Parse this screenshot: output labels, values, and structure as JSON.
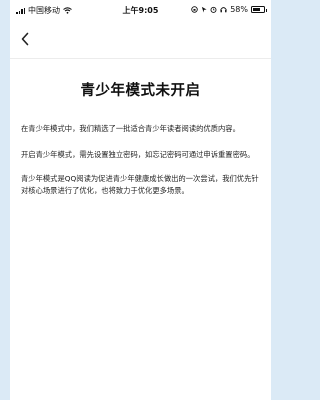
{
  "status_bar": {
    "carrier": "中国移动",
    "time": "上午9:05",
    "battery_percent": "58%",
    "battery_level": 0.58
  },
  "nav": {
    "back_icon": "chevron-left-icon"
  },
  "page": {
    "title": "青少年模式未开启",
    "paragraphs": [
      "在青少年模式中，我们精选了一批适合青少年读者阅读的优质内容。",
      "开启青少年模式，需先设置独立密码，如忘记密码可通过申诉重置密码。",
      "青少年模式是QQ阅读为促进青少年健康成长做出的一次尝试，我们优先针对核心场景进行了优化，也将致力于优化更多场景。"
    ]
  }
}
